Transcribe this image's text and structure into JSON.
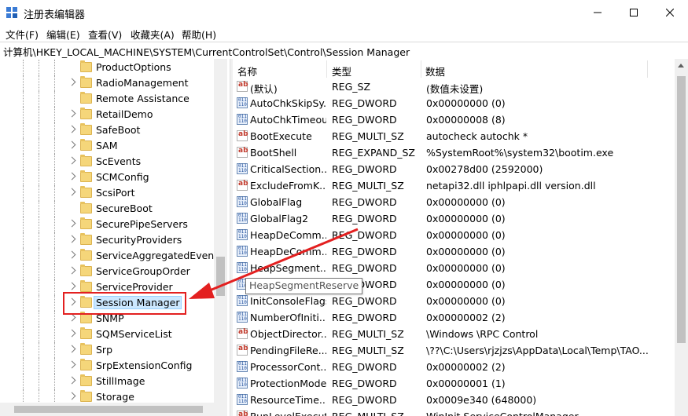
{
  "window": {
    "title": "注册表编辑器",
    "controls": {
      "minimize": "minimize-icon",
      "maximize": "maximize-icon",
      "close": "close-icon"
    }
  },
  "menu": [
    "文件(F)",
    "编辑(E)",
    "查看(V)",
    "收藏夹(A)",
    "帮助(H)"
  ],
  "address": "计算机\\HKEY_LOCAL_MACHINE\\SYSTEM\\CurrentControlSet\\Control\\Session Manager",
  "tree": {
    "items": [
      "ProductOptions",
      "RadioManagement",
      "Remote Assistance",
      "RetailDemo",
      "SafeBoot",
      "SAM",
      "ScEvents",
      "SCMConfig",
      "ScsiPort",
      "SecureBoot",
      "SecurePipeServers",
      "SecurityProviders",
      "ServiceAggregatedEvents",
      "ServiceGroupOrder",
      "ServiceProvider",
      "Session Manager",
      "SNMP",
      "SQMServiceList",
      "Srp",
      "SrpExtensionConfig",
      "StillImage",
      "Storage"
    ],
    "selected": "Session Manager",
    "no_chevron": [
      "ProductOptions",
      "Remote Assistance",
      "SecureBoot"
    ]
  },
  "list": {
    "headers": {
      "name": "名称",
      "type": "类型",
      "data": "数据"
    },
    "rows": [
      {
        "icon": "string-value-icon",
        "name": "(默认)",
        "type": "REG_SZ",
        "data": "(数值未设置)"
      },
      {
        "icon": "binary-value-icon",
        "name": "AutoChkSkipSy...",
        "type": "REG_DWORD",
        "data": "0x00000000 (0)"
      },
      {
        "icon": "binary-value-icon",
        "name": "AutoChkTimeout",
        "type": "REG_DWORD",
        "data": "0x00000008 (8)"
      },
      {
        "icon": "string-value-icon",
        "name": "BootExecute",
        "type": "REG_MULTI_SZ",
        "data": "autocheck autochk *"
      },
      {
        "icon": "string-value-icon",
        "name": "BootShell",
        "type": "REG_EXPAND_SZ",
        "data": "%SystemRoot%\\system32\\bootim.exe"
      },
      {
        "icon": "binary-value-icon",
        "name": "CriticalSection...",
        "type": "REG_DWORD",
        "data": "0x00278d00 (2592000)"
      },
      {
        "icon": "string-value-icon",
        "name": "ExcludeFromK...",
        "type": "REG_MULTI_SZ",
        "data": "netapi32.dll iphlpapi.dll version.dll"
      },
      {
        "icon": "binary-value-icon",
        "name": "GlobalFlag",
        "type": "REG_DWORD",
        "data": "0x00000000 (0)"
      },
      {
        "icon": "binary-value-icon",
        "name": "GlobalFlag2",
        "type": "REG_DWORD",
        "data": "0x00000000 (0)"
      },
      {
        "icon": "binary-value-icon",
        "name": "HeapDeComm...",
        "type": "REG_DWORD",
        "data": "0x00000000 (0)"
      },
      {
        "icon": "binary-value-icon",
        "name": "HeapDeComm...",
        "type": "REG_DWORD",
        "data": "0x00000000 (0)"
      },
      {
        "icon": "binary-value-icon",
        "name": "HeapSegment...",
        "type": "REG_DWORD",
        "data": "0x00000000 (0)"
      },
      {
        "icon": "binary-value-icon",
        "name": "HeapSegmentReserve",
        "type": "REG_DWORD",
        "data": "0x00000000 (0)"
      },
      {
        "icon": "binary-value-icon",
        "name": "InitConsoleFlags",
        "type": "REG_DWORD",
        "data": "0x00000000 (0)"
      },
      {
        "icon": "binary-value-icon",
        "name": "NumberOfIniti...",
        "type": "REG_DWORD",
        "data": "0x00000002 (2)"
      },
      {
        "icon": "string-value-icon",
        "name": "ObjectDirector...",
        "type": "REG_MULTI_SZ",
        "data": "\\Windows \\RPC Control"
      },
      {
        "icon": "string-value-icon",
        "name": "PendingFileRe...",
        "type": "REG_MULTI_SZ",
        "data": "\\??\\C:\\Users\\rjzjzs\\AppData\\Local\\Temp\\TAO..."
      },
      {
        "icon": "binary-value-icon",
        "name": "ProcessorCont...",
        "type": "REG_DWORD",
        "data": "0x00000002 (2)"
      },
      {
        "icon": "binary-value-icon",
        "name": "ProtectionMode",
        "type": "REG_DWORD",
        "data": "0x00000001 (1)"
      },
      {
        "icon": "binary-value-icon",
        "name": "ResourceTime...",
        "type": "REG_DWORD",
        "data": "0x0009e340 (648000)"
      },
      {
        "icon": "string-value-icon",
        "name": "RunLevelExecute",
        "type": "REG_MULTI_SZ",
        "data": "WinInit ServiceControlManager"
      }
    ],
    "tooltip": "HeapSegmentReserve"
  },
  "colors": {
    "annotation_red": "#e32020",
    "selection": "#cce8ff"
  }
}
